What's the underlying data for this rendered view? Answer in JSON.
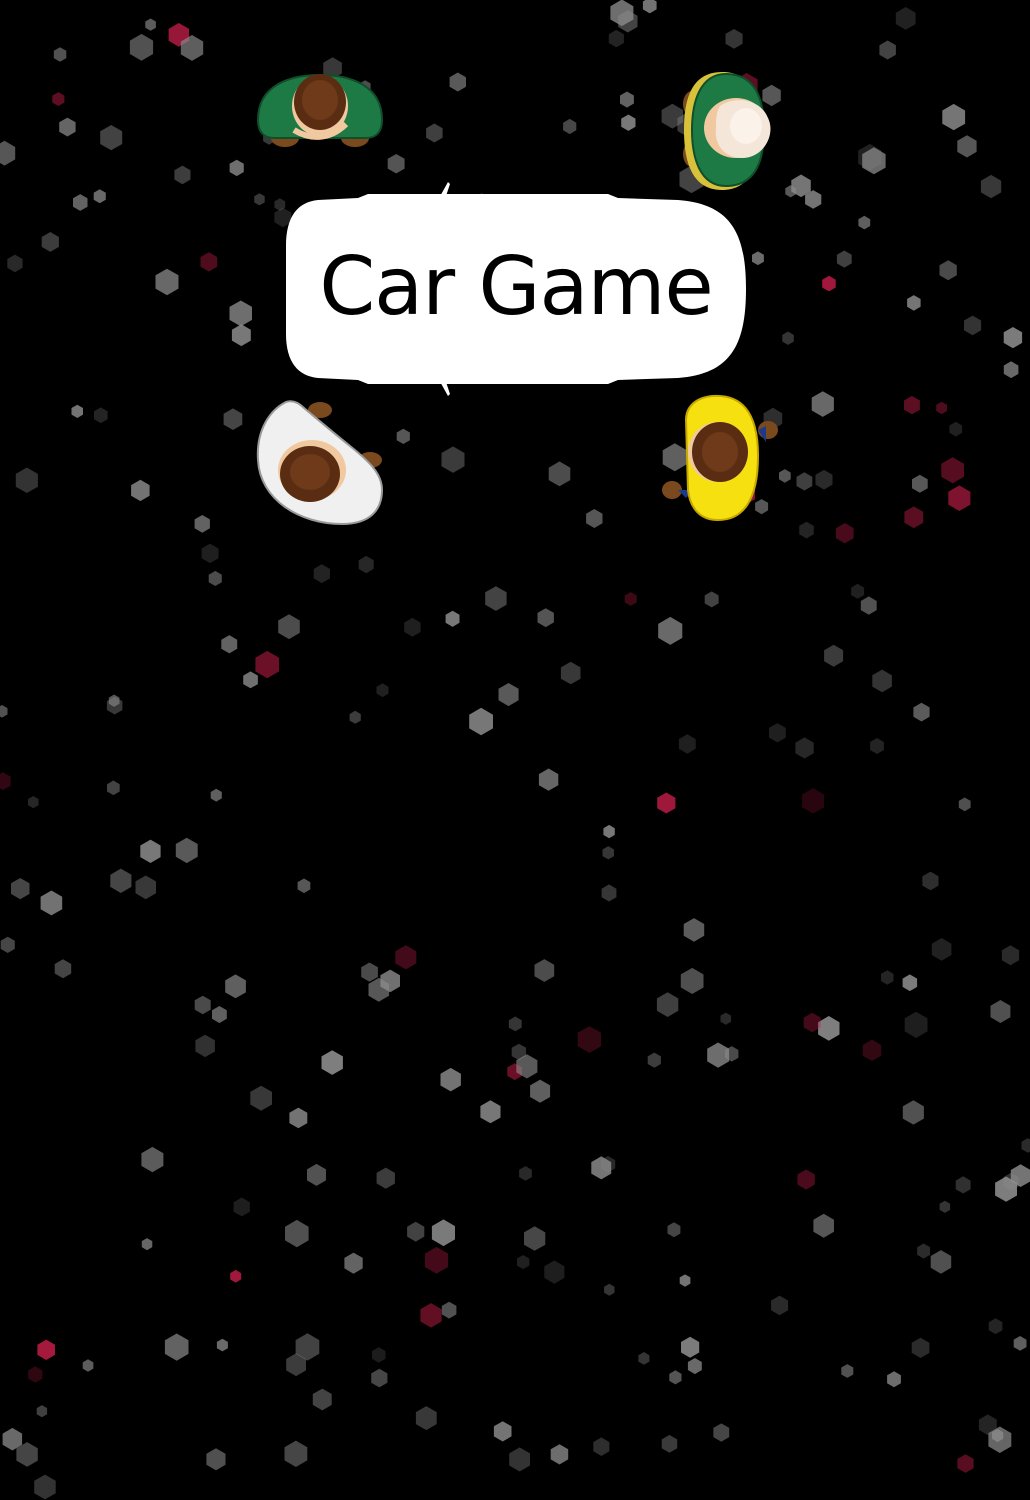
{
  "game": {
    "title": "Car Game"
  },
  "colors": {
    "background": "#000000",
    "particle_gray": "#8c8c8c",
    "particle_red": "#c01d47",
    "car_body": "#ffffff"
  },
  "icons": {
    "title_car": "car-top-view-icon",
    "players": [
      "person-green-shirt-icon",
      "person-green-shirt-white-hair-icon",
      "person-white-shirt-icon",
      "person-yellow-shirt-icon"
    ]
  }
}
